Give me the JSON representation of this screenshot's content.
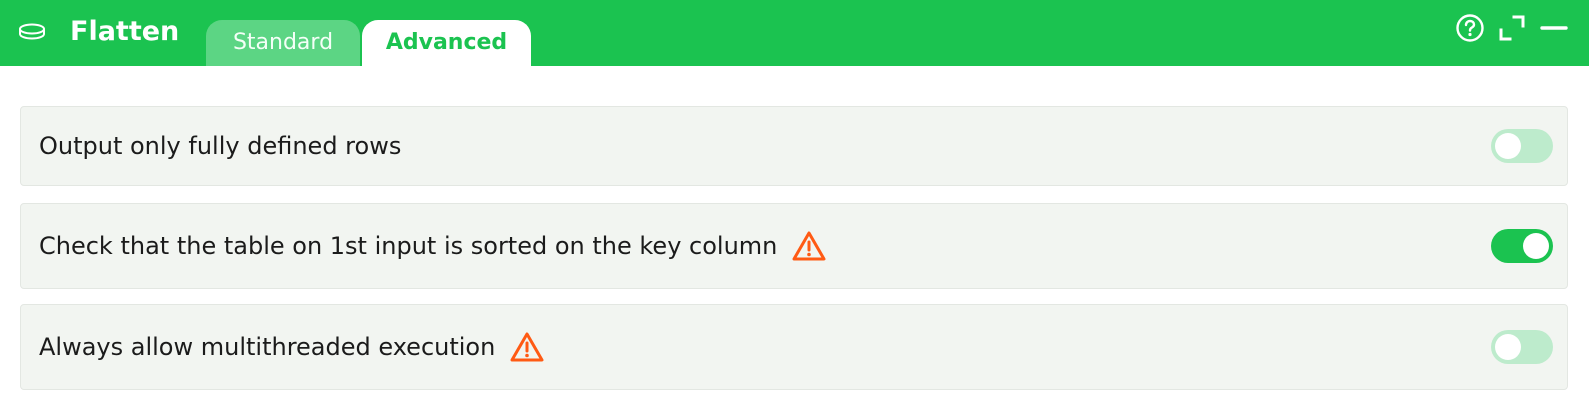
{
  "header": {
    "title": "Flatten",
    "node_icon": "database-stack-icon",
    "tabs": [
      {
        "label": "Standard",
        "active": false
      },
      {
        "label": "Advanced",
        "active": true
      }
    ],
    "actions": [
      {
        "icon": "help-icon"
      },
      {
        "icon": "expand-icon"
      },
      {
        "icon": "minimize-icon"
      }
    ]
  },
  "settings": [
    {
      "label": "Output only fully defined rows",
      "warning": false,
      "enabled": false
    },
    {
      "label": "Check that the table on 1st input is sorted on the key column",
      "warning": true,
      "warning_icon": "warning-triangle-icon",
      "enabled": true
    },
    {
      "label": "Always allow multithreaded execution",
      "warning": true,
      "warning_icon": "warning-triangle-icon",
      "enabled": false
    }
  ],
  "colors": {
    "brand": "#1bc350",
    "warning": "#ff5a14",
    "toggle_off": "#bdebcc",
    "row_bg": "#f2f5f1"
  }
}
